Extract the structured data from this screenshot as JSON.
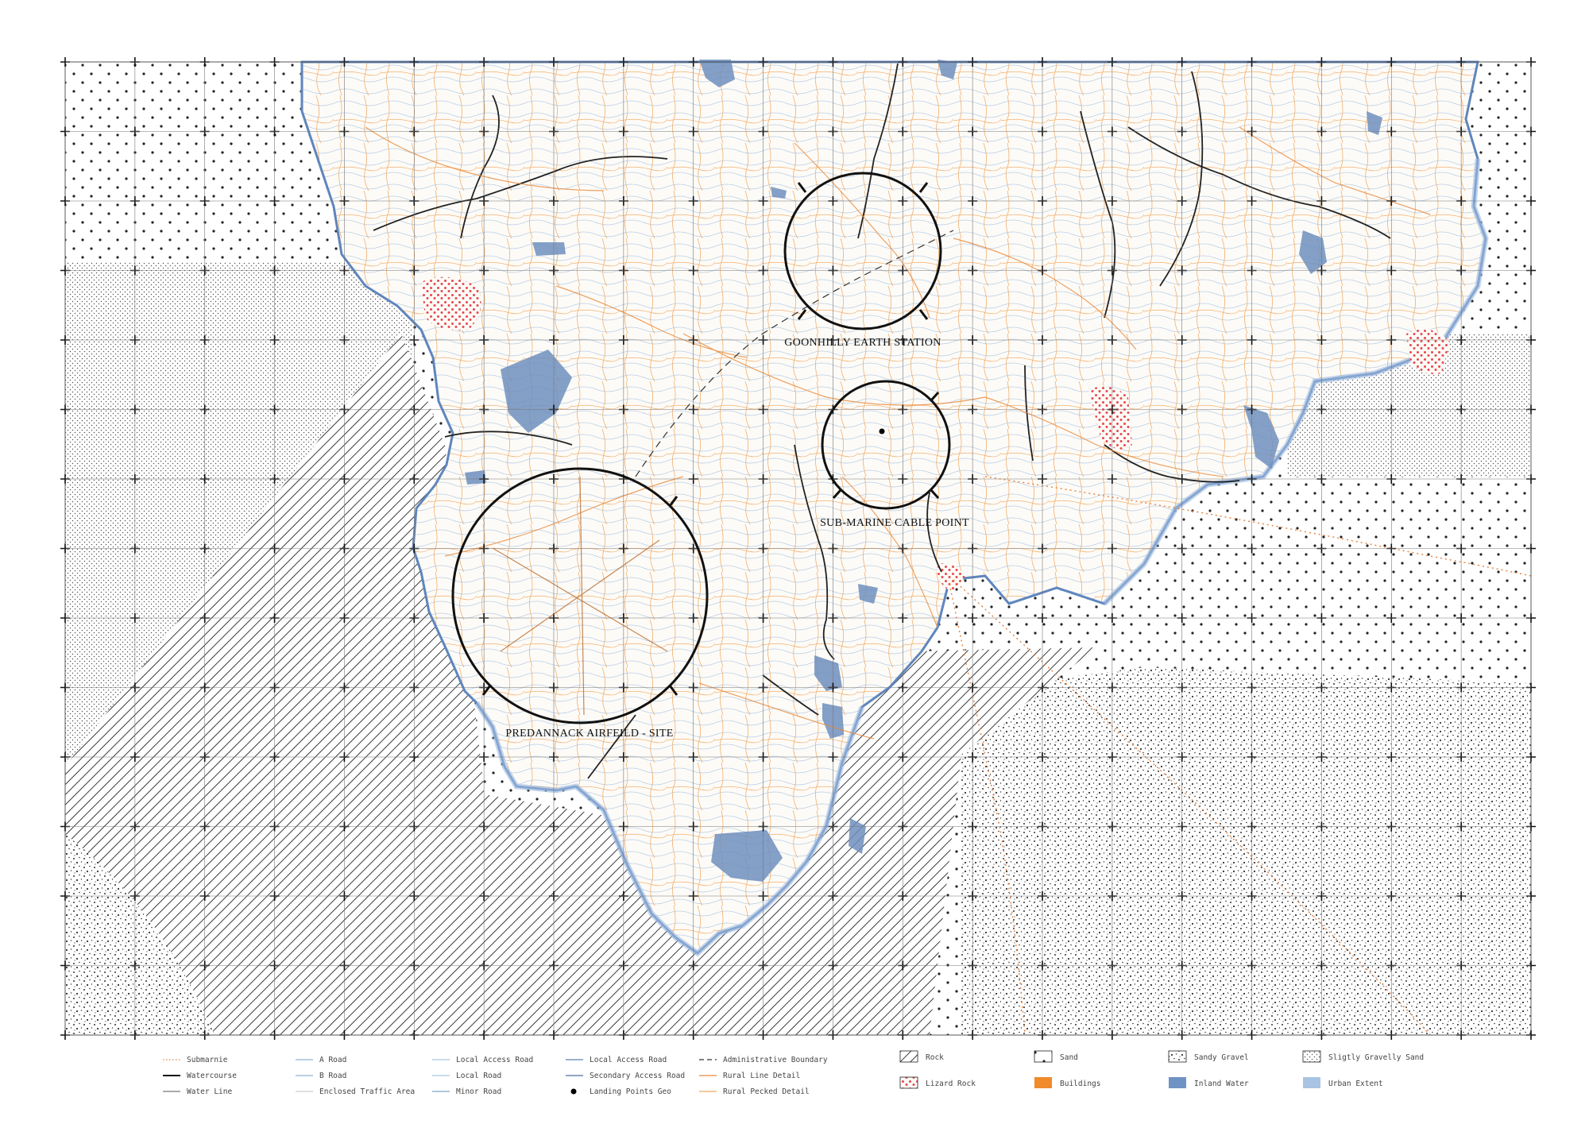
{
  "sites": [
    {
      "label": "GOONHILLY EARTH STATION"
    },
    {
      "label": "SUB-MARINE CABLE POINT"
    },
    {
      "label": "PREDANNACK AIRFEILD - SITE"
    }
  ],
  "legend": {
    "lines": [
      {
        "label": "Submarnie",
        "color": "#e8803a",
        "style": "dotted"
      },
      {
        "label": "Watercourse",
        "color": "#111111",
        "style": "solid-thick"
      },
      {
        "label": "Water Line",
        "color": "#777777",
        "style": "solid"
      },
      {
        "label": "A Road",
        "color": "#8fb2d6",
        "style": "solid"
      },
      {
        "label": "B Road",
        "color": "#8fb2d6",
        "style": "solid"
      },
      {
        "label": "Enclosed Traffic Area",
        "color": "#cccccc",
        "style": "solid"
      },
      {
        "label": "Local Access Road",
        "color": "#a9c6e0",
        "style": "solid"
      },
      {
        "label": "Local Road",
        "color": "#a9c6e0",
        "style": "solid"
      },
      {
        "label": "Minor Road",
        "color": "#7fa3c8",
        "style": "solid"
      },
      {
        "label": "Local Access Road",
        "color": "#5b82b0",
        "style": "solid"
      },
      {
        "label": "Secondary Access Road",
        "color": "#4a70a0",
        "style": "solid"
      },
      {
        "label": "Landing Points Geo",
        "color": "#000000",
        "style": "dot"
      },
      {
        "label": "Administrative Boundary",
        "color": "#333333",
        "style": "dashed"
      },
      {
        "label": "Rural Line Detail",
        "color": "#e8893a",
        "style": "solid"
      },
      {
        "label": "Rural Pecked Detail",
        "color": "#f0a860",
        "style": "solid"
      }
    ],
    "areas": [
      {
        "label": "Rock",
        "pattern": "hatch"
      },
      {
        "label": "Lizard Rock",
        "pattern": "reddots"
      },
      {
        "label": "Sand",
        "pattern": "sand"
      },
      {
        "label": "Buildings",
        "color": "#f08a2a"
      },
      {
        "label": "Sandy Gravel",
        "pattern": "gravel"
      },
      {
        "label": "Inland Water",
        "color": "#6f93c4"
      },
      {
        "label": "Sligtly Gravelly Sand",
        "pattern": "finedots"
      },
      {
        "label": "Urban Extent",
        "color": "#a9c4e2"
      }
    ]
  },
  "colors": {
    "land": "#fdfbf7",
    "coast": "#5f86bd",
    "contour": "#a8c2df",
    "road": "#e8893a",
    "water": "#6f8fbe",
    "river": "#222222",
    "rock": "#444444",
    "lizard": "#e8484e"
  }
}
